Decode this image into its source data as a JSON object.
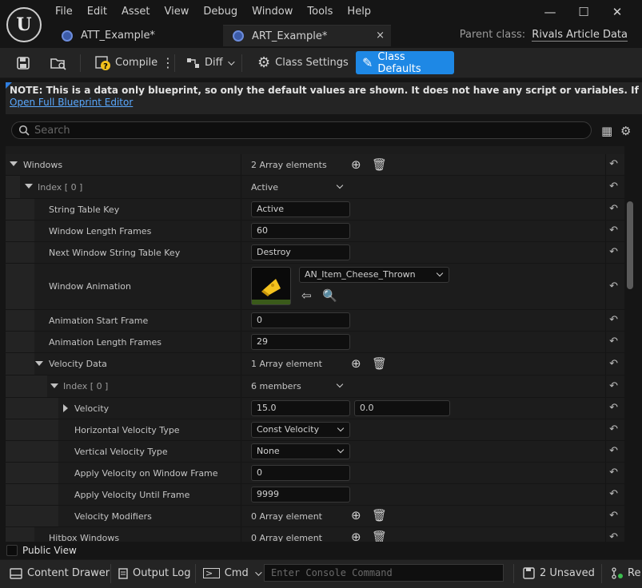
{
  "menu": [
    "File",
    "Edit",
    "Asset",
    "View",
    "Debug",
    "Window",
    "Tools",
    "Help"
  ],
  "window_controls": {
    "minimize": "—",
    "maximize": "☐",
    "close": "✕"
  },
  "tabs": [
    {
      "label": "ATT_Example*",
      "active": false
    },
    {
      "label": "ART_Example*",
      "active": true
    }
  ],
  "tab_close": "×",
  "parent_class": {
    "label": "Parent class:",
    "value": "Rivals Article Data"
  },
  "toolbar": {
    "compile": "Compile",
    "diff": "Diff",
    "class_settings": "Class Settings",
    "class_defaults": "Class Defaults"
  },
  "note": {
    "text": "NOTE: This is a data only blueprint, so only the default values are shown.  It does not have any script or variables.  If you want to add some, use the",
    "link": "Open Full Blueprint Editor"
  },
  "search": {
    "placeholder": "Search"
  },
  "rows": {
    "windows": {
      "label": "Windows",
      "value": "2 Array elements"
    },
    "index0": {
      "label": "Index [ 0 ]",
      "value": "Active"
    },
    "string_table_key": {
      "label": "String Table Key",
      "value": "Active"
    },
    "window_length_frames": {
      "label": "Window Length Frames",
      "value": "60"
    },
    "next_window_key": {
      "label": "Next Window String Table Key",
      "value": "Destroy"
    },
    "window_animation": {
      "label": "Window Animation",
      "value": "AN_Item_Cheese_Thrown"
    },
    "anim_start_frame": {
      "label": "Animation Start Frame",
      "value": "0"
    },
    "anim_length_frames": {
      "label": "Animation Length Frames",
      "value": "29"
    },
    "velocity_data": {
      "label": "Velocity Data",
      "value": "1 Array element"
    },
    "vindex0": {
      "label": "Index [ 0 ]",
      "value": "6 members"
    },
    "velocity": {
      "label": "Velocity",
      "x": "15.0",
      "y": "0.0"
    },
    "h_vel_type": {
      "label": "Horizontal Velocity Type",
      "value": "Const Velocity"
    },
    "v_vel_type": {
      "label": "Vertical Velocity Type",
      "value": "None"
    },
    "apply_on_frame": {
      "label": "Apply Velocity on Window Frame",
      "value": "0"
    },
    "apply_until": {
      "label": "Apply Velocity Until Frame",
      "value": "9999"
    },
    "vel_mods": {
      "label": "Velocity Modifiers",
      "value": "0 Array element"
    },
    "hitbox_windows": {
      "label": "Hitbox Windows",
      "value": "0 Array element"
    }
  },
  "public_view": "Public View",
  "status": {
    "content_drawer": "Content Drawer",
    "output_log": "Output Log",
    "cmd": "Cmd",
    "console_placeholder": "Enter Console Command",
    "unsaved": "2 Unsaved",
    "revision": "Re"
  },
  "colors": {
    "accent": "#1e88e5",
    "background": "#151515",
    "panel": "#242424",
    "link": "#5aa9ff"
  }
}
